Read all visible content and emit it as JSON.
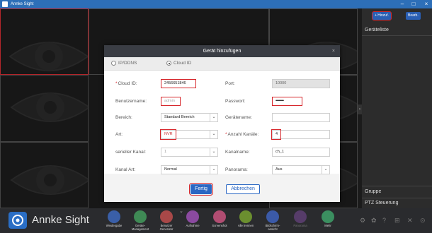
{
  "window": {
    "title": "Annke Sight",
    "min_icon": "minimize-icon",
    "max_icon": "maximize-icon",
    "close_icon": "close-icon"
  },
  "right_panel": {
    "add_button": "+ Hinzuf.",
    "edit_button": "Bearb.",
    "device_list_title": "Geräteliste",
    "group_title": "Gruppe",
    "ptz_title": "PTZ Steuerung"
  },
  "toolbar": {
    "brand": "Annke Sight",
    "items": [
      {
        "label": "Wiedergabe",
        "icon": "playback-icon",
        "color": "#3a5fa8"
      },
      {
        "label": "Geräte-\nManagement",
        "icon": "device-management-icon",
        "color": "#3f8a55"
      },
      {
        "label": "Benutzer\nGenerator",
        "icon": "user-generator-icon",
        "color": "#a84848"
      },
      {
        "label": "Aufnahme",
        "icon": "recording-icon",
        "color": "#8b4aa0"
      },
      {
        "label": "Screenshot",
        "icon": "screenshot-icon",
        "color": "#b14d72"
      },
      {
        "label": "Alle trennen",
        "icon": "disconnect-all-icon",
        "color": "#6b8f2f"
      },
      {
        "label": "Bildschirm-\nansicht",
        "icon": "screen-view-icon",
        "color": "#3b5aa8"
      },
      {
        "label": "Panorama",
        "icon": "panorama-icon",
        "color": "#7a4a9a"
      },
      {
        "label": "Mehr",
        "icon": "more-icon",
        "color": "#3b8f60"
      }
    ]
  },
  "dialog": {
    "title": "Gerät hinzufügen",
    "close": "×",
    "mode_options": [
      "IP/DDNS",
      "Cloud ID"
    ],
    "selected_mode": "Cloud ID",
    "fields": {
      "cloud_id": {
        "label": "Cloud ID:",
        "value": "2456651846"
      },
      "port": {
        "label": "Port:",
        "value": "10000"
      },
      "username": {
        "label": "Benutzername:",
        "value": "admin"
      },
      "password": {
        "label": "Passwort:",
        "value": "••••••••••••"
      },
      "area": {
        "label": "Bereich:",
        "value": "Standard Bereich"
      },
      "device_name": {
        "label": "Gerätename:",
        "value": ""
      },
      "type": {
        "label": "Art:",
        "value": "NVR"
      },
      "channel_count": {
        "label": "Anzahl Kanäle:",
        "value": "4"
      },
      "serial_channel": {
        "label": "serieller Kanal:",
        "value": "1"
      },
      "channel_name": {
        "label": "Kanalname:",
        "value": "ch_1"
      },
      "channel_type": {
        "label": "Kanal Art:",
        "value": "Normal"
      },
      "panorama": {
        "label": "Panorama:",
        "value": "Aus"
      }
    },
    "confirm_button": "Fertig",
    "cancel_button": "Abbrechen"
  }
}
